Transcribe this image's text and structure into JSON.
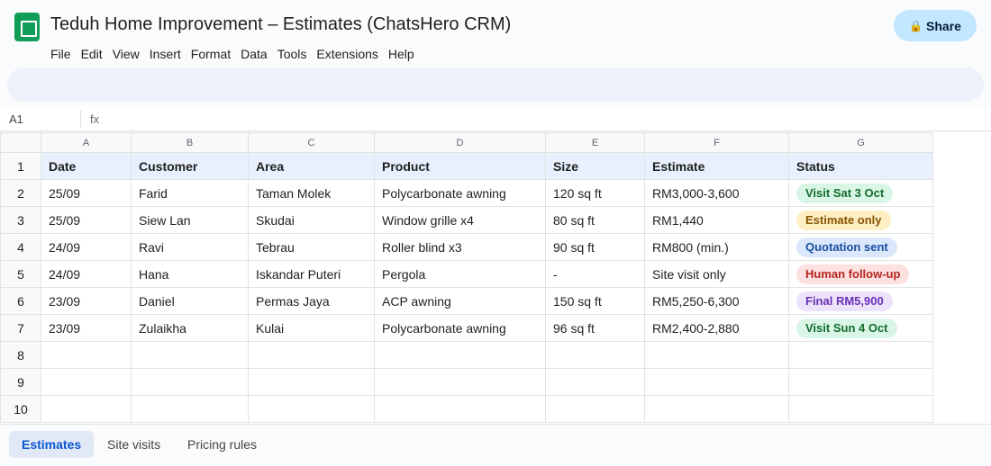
{
  "app": {
    "title": "Teduh Home Improvement – Estimates (ChatsHero CRM)",
    "logo_icon": "sheets-logo-icon",
    "share_label": "Share",
    "share_icon": "🔒",
    "brand_color": "#0f9d58"
  },
  "menu": [
    "File",
    "Edit",
    "View",
    "Insert",
    "Format",
    "Data",
    "Tools",
    "Extensions",
    "Help"
  ],
  "formula_bar": {
    "cell_ref": "A1",
    "fx": "fx"
  },
  "columns": [
    "A",
    "B",
    "C",
    "D",
    "E",
    "F",
    "G"
  ],
  "header_row": [
    "Date",
    "Customer",
    "Area",
    "Product",
    "Size",
    "Estimate",
    "Status"
  ],
  "rows": [
    {
      "cells": [
        "25/09",
        "Farid",
        "Taman Molek",
        "Polycarbonate awning",
        "120 sq ft",
        "RM3,000-3,600"
      ],
      "status": {
        "text": "Visit Sat 3 Oct",
        "bg": "#d9f5e6",
        "fg": "#146c2e"
      }
    },
    {
      "cells": [
        "25/09",
        "Siew Lan",
        "Skudai",
        "Window grille x4",
        "80 sq ft",
        "RM1,440"
      ],
      "status": {
        "text": "Estimate only",
        "bg": "#fdefc3",
        "fg": "#8a5300"
      }
    },
    {
      "cells": [
        "24/09",
        "Ravi",
        "Tebrau",
        "Roller blind x3",
        "90 sq ft",
        "RM800 (min.)"
      ],
      "status": {
        "text": "Quotation sent",
        "bg": "#dbe7fb",
        "fg": "#1a4fa0"
      }
    },
    {
      "cells": [
        "24/09",
        "Hana",
        "Iskandar Puteri",
        "Pergola",
        "-",
        "Site visit only"
      ],
      "status": {
        "text": "Human follow-up",
        "bg": "#fde0e0",
        "fg": "#b3261e"
      }
    },
    {
      "cells": [
        "23/09",
        "Daniel",
        "Permas Jaya",
        "ACP awning",
        "150 sq ft",
        "RM5,250-6,300"
      ],
      "status": {
        "text": "Final RM5,900",
        "bg": "#ece3fb",
        "fg": "#6a2fb5"
      }
    },
    {
      "cells": [
        "23/09",
        "Zulaikha",
        "Kulai",
        "Polycarbonate awning",
        "96 sq ft",
        "RM2,400-2,880"
      ],
      "status": {
        "text": "Visit Sun 4 Oct",
        "bg": "#d9f5e6",
        "fg": "#146c2e"
      }
    }
  ],
  "row_numbers": [
    "1",
    "2",
    "3",
    "4",
    "5",
    "6",
    "7",
    "8",
    "9",
    "10"
  ],
  "sheet_tabs": [
    {
      "label": "Estimates",
      "active": true
    },
    {
      "label": "Site visits",
      "active": false
    },
    {
      "label": "Pricing rules",
      "active": false
    }
  ]
}
